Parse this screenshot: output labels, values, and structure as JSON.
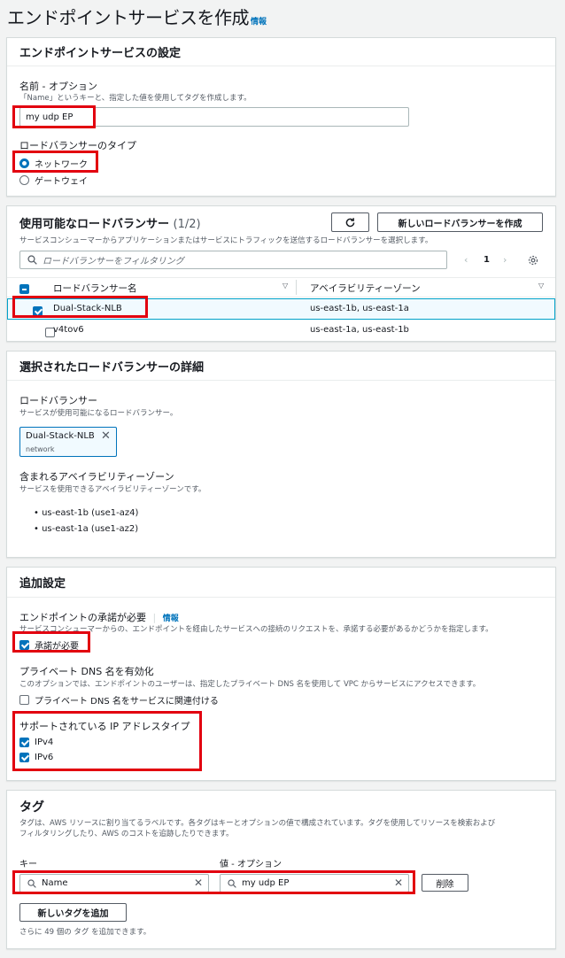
{
  "page": {
    "title": "エンドポイントサービスを作成",
    "info_link": "情報"
  },
  "settings": {
    "heading": "エンドポイントサービスの設定",
    "name_label": "名前 - オプション",
    "name_desc": "「Name」というキーと、指定した値を使用してタグを作成します。",
    "name_value": "my udp EP",
    "lb_type_label": "ロードバランサーのタイプ",
    "lb_type_options": [
      {
        "label": "ネットワーク",
        "selected": true
      },
      {
        "label": "ゲートウェイ",
        "selected": false
      }
    ]
  },
  "available_lbs": {
    "heading": "使用可能なロードバランサー",
    "count": "(1/2)",
    "refresh_icon": "refresh-icon",
    "create_button": "新しいロードバランサーを作成",
    "desc": "サービスコンシューマーからアプリケーションまたはサービスにトラフィックを送信するロードバランサーを選択します。",
    "filter_placeholder": "ロードバランサーをフィルタリング",
    "page_number": "1",
    "columns": [
      "ロードバランサー名",
      "アベイラビリティーゾーン"
    ],
    "rows": [
      {
        "name": "Dual-Stack-NLB",
        "azs": "us-east-1b, us-east-1a",
        "selected": true
      },
      {
        "name": "v4tov6",
        "azs": "us-east-1a, us-east-1b",
        "selected": false
      }
    ]
  },
  "selected_lb_details": {
    "heading": "選択されたロードバランサーの詳細",
    "lb_label": "ロードバランサー",
    "lb_desc": "サービスが使用可能になるロードバランサー。",
    "token_name": "Dual-Stack-NLB",
    "token_sub": "network",
    "az_label": "含まれるアベイラビリティーゾーン",
    "az_desc": "サービスを使用できるアベイラビリティーゾーンです。",
    "azs": [
      "us-east-1b (use1-az4)",
      "us-east-1a (use1-az2)"
    ]
  },
  "additional": {
    "heading": "追加設定",
    "acceptance_label": "エンドポイントの承諾が必要",
    "acceptance_info": "情報",
    "acceptance_desc": "サービスコンシューマーからの、エンドポイントを経由したサービスへの接続のリクエストを、承諾する必要があるかどうかを指定します。",
    "acceptance_checkbox": "承諾が必要",
    "private_dns_label": "プライベート DNS 名を有効化",
    "private_dns_desc": "このオプションでは、エンドポイントのユーザーは、指定したプライベート DNS 名を使用して VPC からサービスにアクセスできます。",
    "private_dns_checkbox": "プライベート DNS 名をサービスに関連付ける",
    "ip_type_label": "サポートされている IP アドレスタイプ",
    "ip_types": [
      "IPv4",
      "IPv6"
    ]
  },
  "tags": {
    "heading": "タグ",
    "desc_line1": "タグは、AWS リソースに割り当てるラベルです。各タグはキーとオプションの値で構成されています。タグを使用してリソースを検索および",
    "desc_line2": "フィルタリングしたり、AWS のコストを追跡したりできます。",
    "key_label": "キー",
    "value_label": "値 - オプション",
    "key_value": "Name",
    "value_value": "my udp EP",
    "remove_button": "削除",
    "add_button": "新しいタグを追加",
    "remaining": "さらに 49 個の タグ を追加できます。"
  },
  "colors": {
    "accent": "#0073bb",
    "highlight": "#e2000f"
  }
}
